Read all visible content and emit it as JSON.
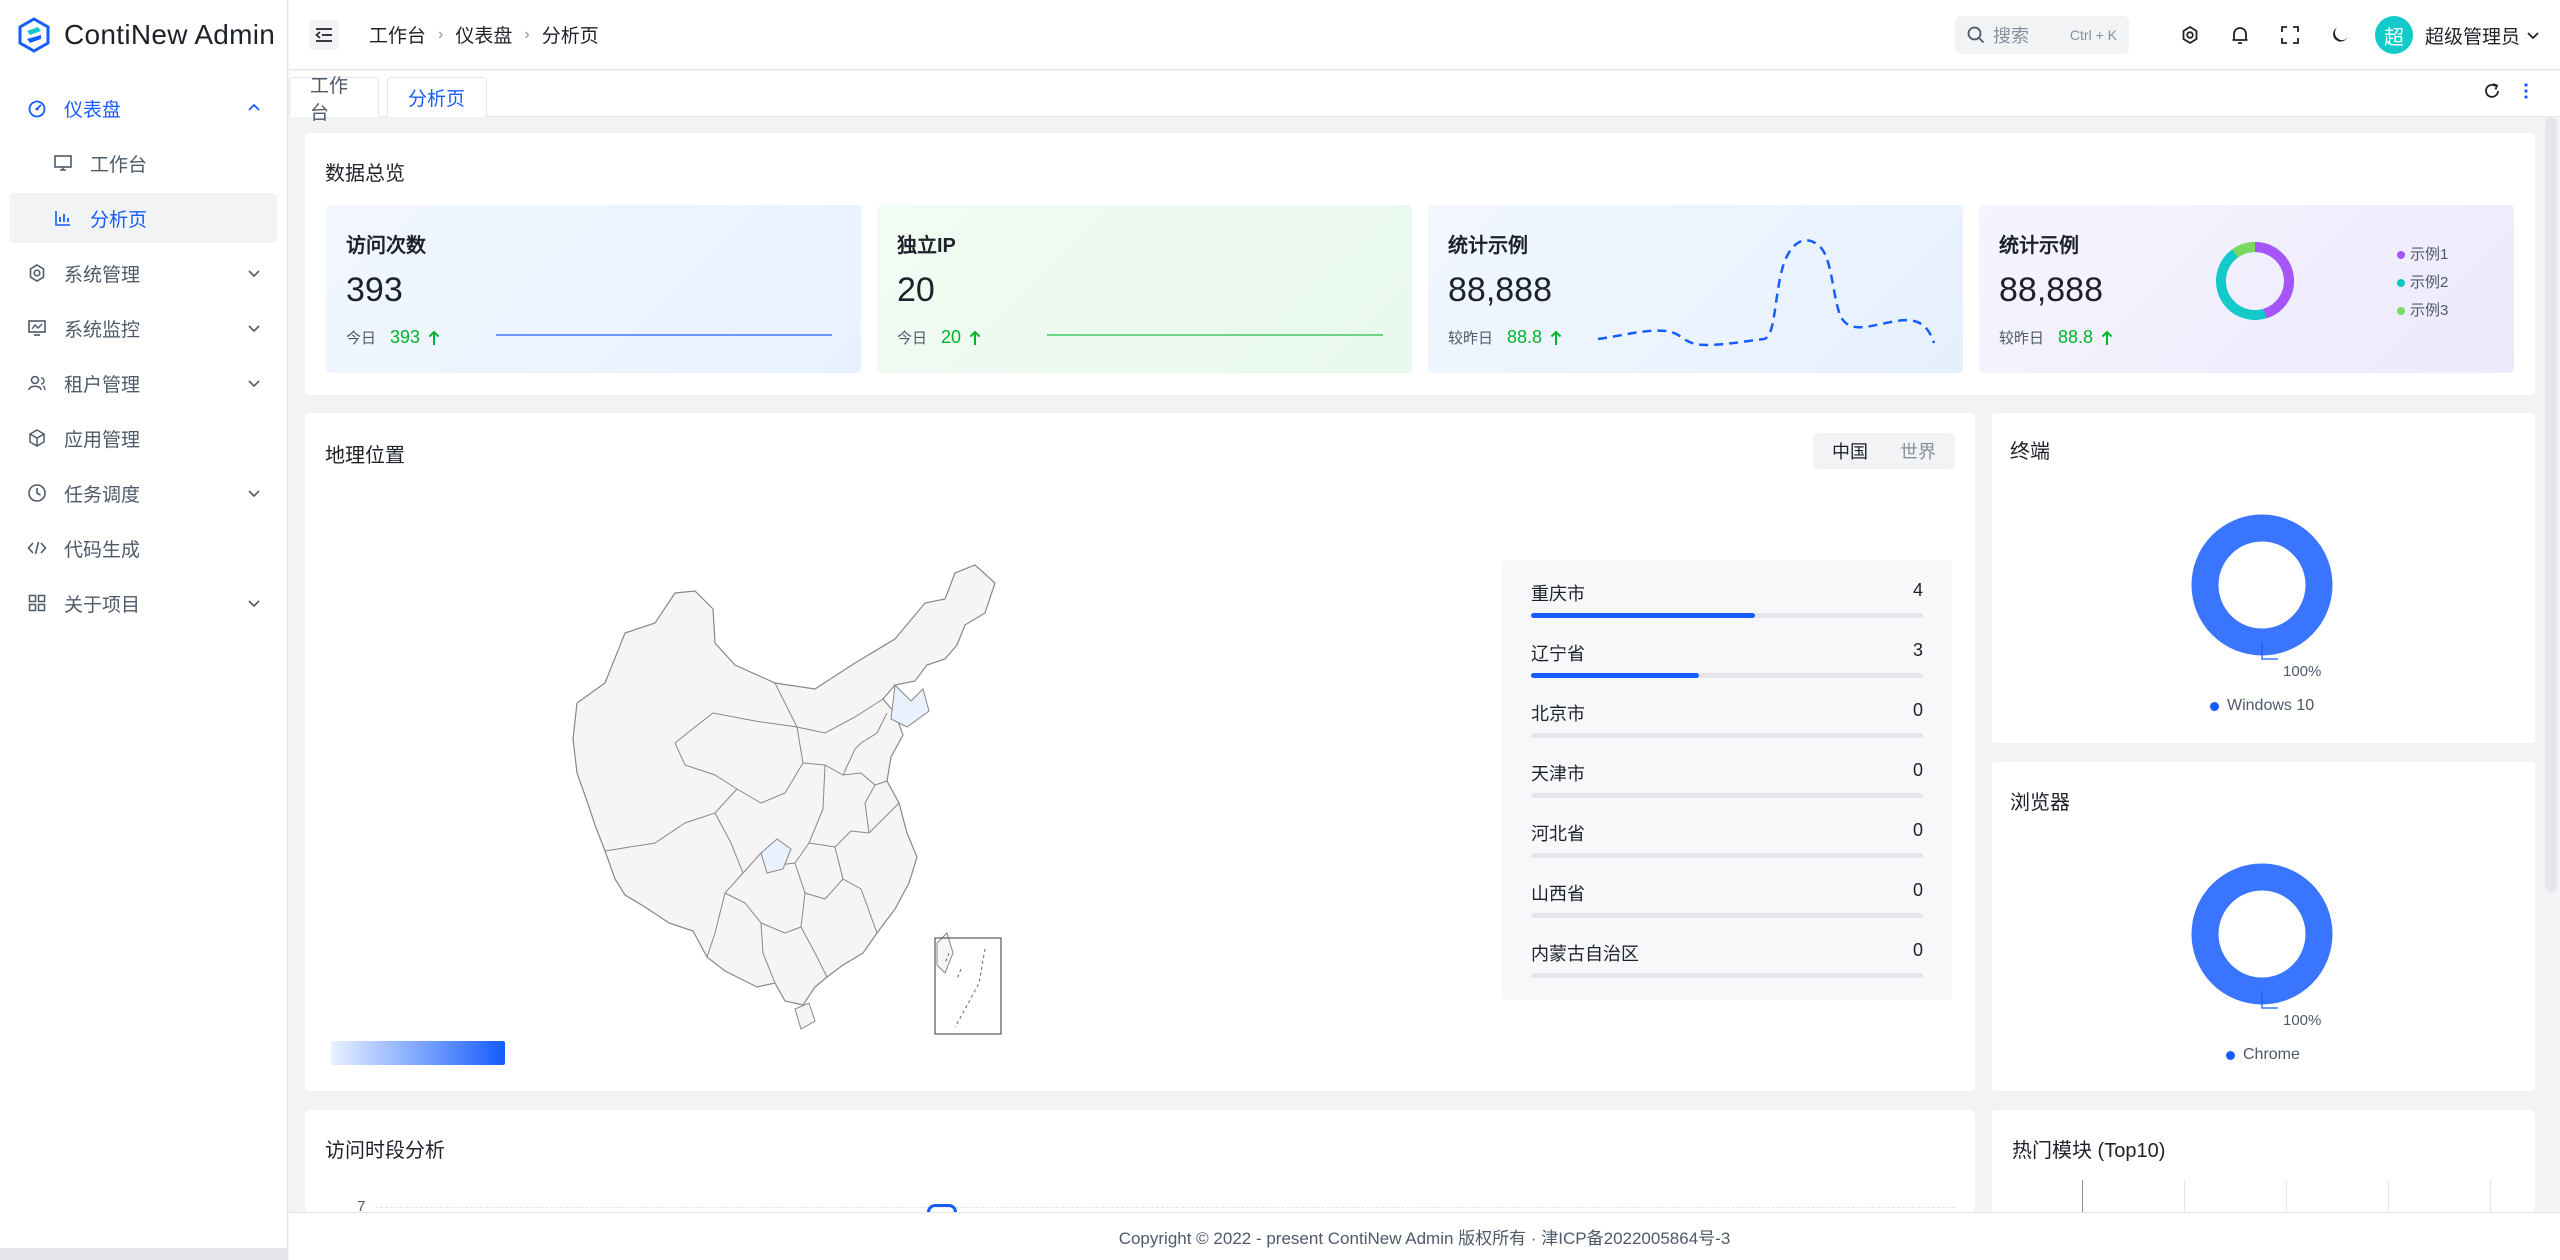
{
  "app": {
    "name": "ContiNew Admin"
  },
  "sidebar": {
    "items": [
      {
        "label": "仪表盘",
        "icon": "dashboard-icon",
        "expanded": true
      },
      {
        "label": "工作台",
        "icon": "desktop-icon"
      },
      {
        "label": "分析页",
        "icon": "bar-chart-icon",
        "active": true
      },
      {
        "label": "系统管理",
        "icon": "gear-icon"
      },
      {
        "label": "系统监控",
        "icon": "monitor-icon"
      },
      {
        "label": "租户管理",
        "icon": "user-group-icon"
      },
      {
        "label": "应用管理",
        "icon": "cube-icon"
      },
      {
        "label": "任务调度",
        "icon": "clock-icon"
      },
      {
        "label": "代码生成",
        "icon": "code-icon"
      },
      {
        "label": "关于项目",
        "icon": "apps-icon"
      }
    ]
  },
  "header": {
    "breadcrumb": [
      "工作台",
      "仪表盘",
      "分析页"
    ],
    "search_placeholder": "搜索",
    "search_shortcut": "Ctrl + K",
    "avatar_text": "超",
    "username": "超级管理员"
  },
  "tabs": [
    {
      "label": "工作台"
    },
    {
      "label": "分析页",
      "active": true
    }
  ],
  "overview": {
    "title": "数据总览",
    "cards": [
      {
        "title": "访问次数",
        "value": "393",
        "foot_label": "今日",
        "foot_value": "393"
      },
      {
        "title": "独立IP",
        "value": "20",
        "foot_label": "今日",
        "foot_value": "20"
      },
      {
        "title": "统计示例",
        "value": "88,888",
        "foot_label": "较昨日",
        "foot_value": "88.8"
      },
      {
        "title": "统计示例",
        "value": "88,888",
        "foot_label": "较昨日",
        "foot_value": "88.8",
        "legend": [
          "示例1",
          "示例2",
          "示例3"
        ]
      }
    ]
  },
  "geo": {
    "title": "地理位置",
    "segment": [
      "中国",
      "世界"
    ],
    "ranking": [
      {
        "name": "重庆市",
        "value": 4
      },
      {
        "name": "辽宁省",
        "value": 3
      },
      {
        "name": "北京市",
        "value": 0
      },
      {
        "name": "天津市",
        "value": 0
      },
      {
        "name": "河北省",
        "value": 0
      },
      {
        "name": "山西省",
        "value": 0
      },
      {
        "name": "内蒙古自治区",
        "value": 0
      }
    ],
    "rank_max": 7
  },
  "terminal": {
    "title": "终端",
    "percent_label": "100%",
    "legend": "Windows 10"
  },
  "browser": {
    "title": "浏览器",
    "percent_label": "100%",
    "legend": "Chrome"
  },
  "time_analysis": {
    "title": "访问时段分析",
    "y_top": "7"
  },
  "hot_modules": {
    "title": "热门模块 (Top10)"
  },
  "footer": {
    "text": "Copyright © 2022 - present ContiNew Admin 版权所有 · 津ICP备2022005864号-3"
  },
  "colors": {
    "primary": "#165dff",
    "success": "#00b42a",
    "teal": "#14c9c9",
    "purple": "#a855f7",
    "cyan": "#0fc6c2",
    "green": "#7bd95f"
  }
}
